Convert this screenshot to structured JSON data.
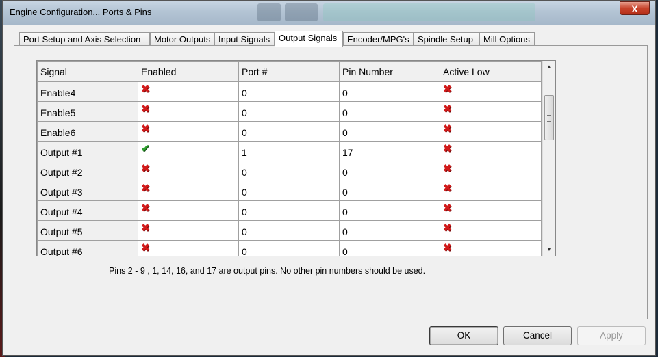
{
  "window": {
    "title": "Engine Configuration... Ports & Pins",
    "close_symbol": "X"
  },
  "tabs": [
    {
      "label": "Port Setup and Axis Selection",
      "active": false
    },
    {
      "label": "Motor Outputs",
      "active": false
    },
    {
      "label": "Input Signals",
      "active": false
    },
    {
      "label": "Output Signals",
      "active": true
    },
    {
      "label": "Encoder/MPG's",
      "active": false
    },
    {
      "label": "Spindle Setup",
      "active": false
    },
    {
      "label": "Mill Options",
      "active": false
    }
  ],
  "table": {
    "columns": [
      "Signal",
      "Enabled",
      "Port #",
      "Pin Number",
      "Active Low"
    ],
    "rows": [
      {
        "signal": "Enable4",
        "enabled": false,
        "port": "0",
        "pin": "0",
        "active_low": false
      },
      {
        "signal": "Enable5",
        "enabled": false,
        "port": "0",
        "pin": "0",
        "active_low": false
      },
      {
        "signal": "Enable6",
        "enabled": false,
        "port": "0",
        "pin": "0",
        "active_low": false
      },
      {
        "signal": "Output #1",
        "enabled": true,
        "port": "1",
        "pin": "17",
        "active_low": false
      },
      {
        "signal": "Output #2",
        "enabled": false,
        "port": "0",
        "pin": "0",
        "active_low": false
      },
      {
        "signal": "Output #3",
        "enabled": false,
        "port": "0",
        "pin": "0",
        "active_low": false
      },
      {
        "signal": "Output #4",
        "enabled": false,
        "port": "0",
        "pin": "0",
        "active_low": false
      },
      {
        "signal": "Output #5",
        "enabled": false,
        "port": "0",
        "pin": "0",
        "active_low": false
      },
      {
        "signal": "Output #6",
        "enabled": false,
        "port": "0",
        "pin": "0",
        "active_low": false
      }
    ],
    "icons": {
      "enabled_true": "green-check-icon",
      "enabled_false": "red-x-icon"
    }
  },
  "note": "Pins 2 - 9 , 1, 14, 16, and 17 are output pins. No  other pin numbers should be used.",
  "buttons": {
    "ok": "OK",
    "cancel": "Cancel",
    "apply": "Apply"
  },
  "colors": {
    "close_button": "#c7432b",
    "x_mark": "#d21a1a",
    "check_mark": "#2fa02f"
  }
}
